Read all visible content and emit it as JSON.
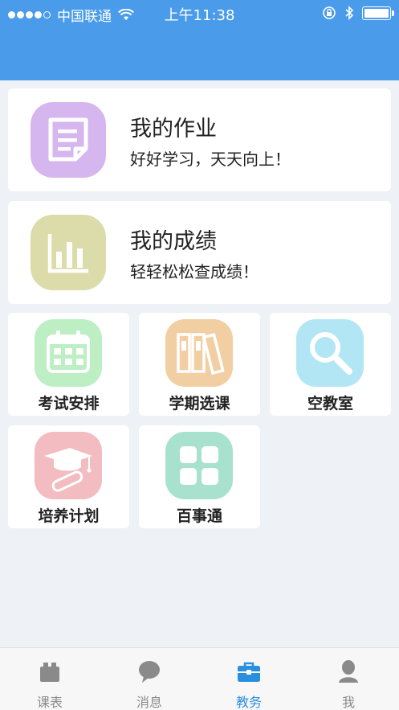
{
  "status_bar": {
    "carrier": "中国联通",
    "time": "上午11:38"
  },
  "cards": [
    {
      "title": "我的作业",
      "subtitle": "好好学习，天天向上！",
      "icon": "homework-icon",
      "color": "#d6b6ee"
    },
    {
      "title": "我的成绩",
      "subtitle": "轻轻松松查成绩！",
      "icon": "chart-icon",
      "color": "#dcdcaa"
    }
  ],
  "tiles": [
    {
      "label": "考试安排",
      "icon": "calendar-icon",
      "color": "#bdeec4"
    },
    {
      "label": "学期选课",
      "icon": "books-icon",
      "color": "#f2cfa3"
    },
    {
      "label": "空教室",
      "icon": "magnifier-icon",
      "color": "#b3e6f4"
    },
    {
      "label": "培养计划",
      "icon": "graduation-cap-icon",
      "color": "#f3bcc0"
    },
    {
      "label": "百事通",
      "icon": "grid-icon",
      "color": "#a8e2cf"
    }
  ],
  "tabbar": {
    "items": [
      {
        "label": "课表",
        "icon": "schedule-icon",
        "active": false
      },
      {
        "label": "消息",
        "icon": "message-icon",
        "active": false
      },
      {
        "label": "教务",
        "icon": "briefcase-icon",
        "active": true
      },
      {
        "label": "我",
        "icon": "person-icon",
        "active": false
      }
    ],
    "active_color": "#2b8fe0",
    "inactive_color": "#8a8a8a"
  }
}
